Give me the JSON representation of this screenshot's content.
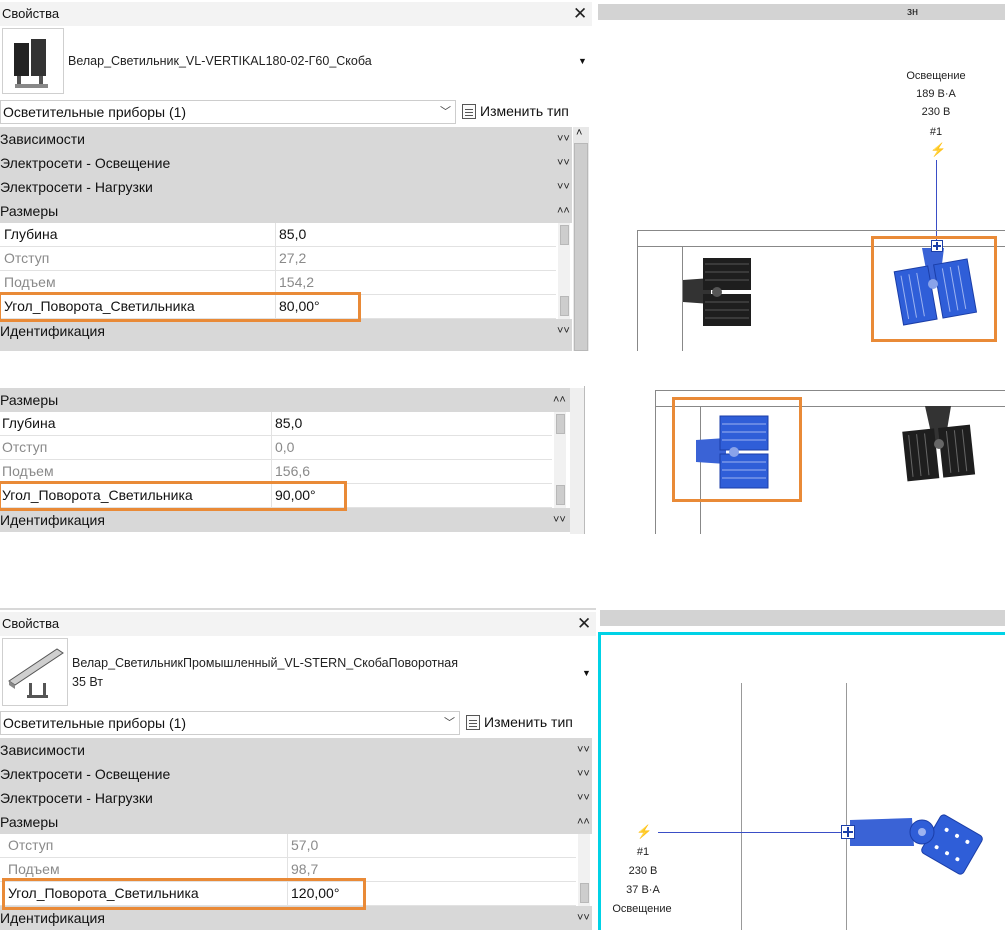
{
  "colors": {
    "highlight": "#e98a37",
    "selected_fixture": "#2f5ed8",
    "active_view_border": "#00d2e6",
    "group_bg": "#d8d8d8"
  },
  "panel1": {
    "title": "Свойства",
    "family": "Велар_Светильник_VL-VERTIKAL180-02-Г60_Скоба",
    "category": "Осветительные приборы (1)",
    "edit_type": "Изменить тип",
    "groups": [
      "Зависимости",
      "Электросети - Освещение",
      "Электросети - Нагрузки",
      "Размеры",
      "Идентификация"
    ],
    "params": [
      {
        "name": "Глубина",
        "value": "85,0"
      },
      {
        "name": "Отступ",
        "value": "27,2"
      },
      {
        "name": "Подъем",
        "value": "154,2"
      },
      {
        "name": "Угол_Поворота_Светильника",
        "value": "80,00°"
      }
    ]
  },
  "view1": {
    "header": "зн",
    "circuit": {
      "name": "Освещение",
      "load": "189 В·А",
      "voltage": "230 В",
      "number": "#1"
    }
  },
  "panel2": {
    "groups": [
      "Размеры",
      "Идентификация"
    ],
    "params": [
      {
        "name": "Глубина",
        "value": "85,0"
      },
      {
        "name": "Отступ",
        "value": "0,0"
      },
      {
        "name": "Подъем",
        "value": "156,6"
      },
      {
        "name": "Угол_Поворота_Светильника",
        "value": "90,00°"
      }
    ]
  },
  "panel3": {
    "title": "Свойства",
    "family_line1": "Велар_СветильникПромышленный_VL-STERN_СкобаПоворотная",
    "family_line2": "35 Вт",
    "category": "Осветительные приборы (1)",
    "edit_type": "Изменить тип",
    "groups": [
      "Зависимости",
      "Электросети - Освещение",
      "Электросети - Нагрузки",
      "Размеры",
      "Идентификация"
    ],
    "params": [
      {
        "name": "Отступ",
        "value": "57,0"
      },
      {
        "name": "Подъем",
        "value": "98,7"
      },
      {
        "name": "Угол_Поворота_Светильника",
        "value": "120,00°"
      }
    ]
  },
  "view3": {
    "circuit": {
      "number": "#1",
      "voltage": "230 В",
      "load": "37 В·А",
      "name": "Освещение"
    }
  },
  "icons": [
    "close-icon",
    "dropdown-arrow-icon",
    "edit-type-icon",
    "collapse-icon",
    "expand-icon",
    "lightning-icon",
    "connector-icon"
  ]
}
